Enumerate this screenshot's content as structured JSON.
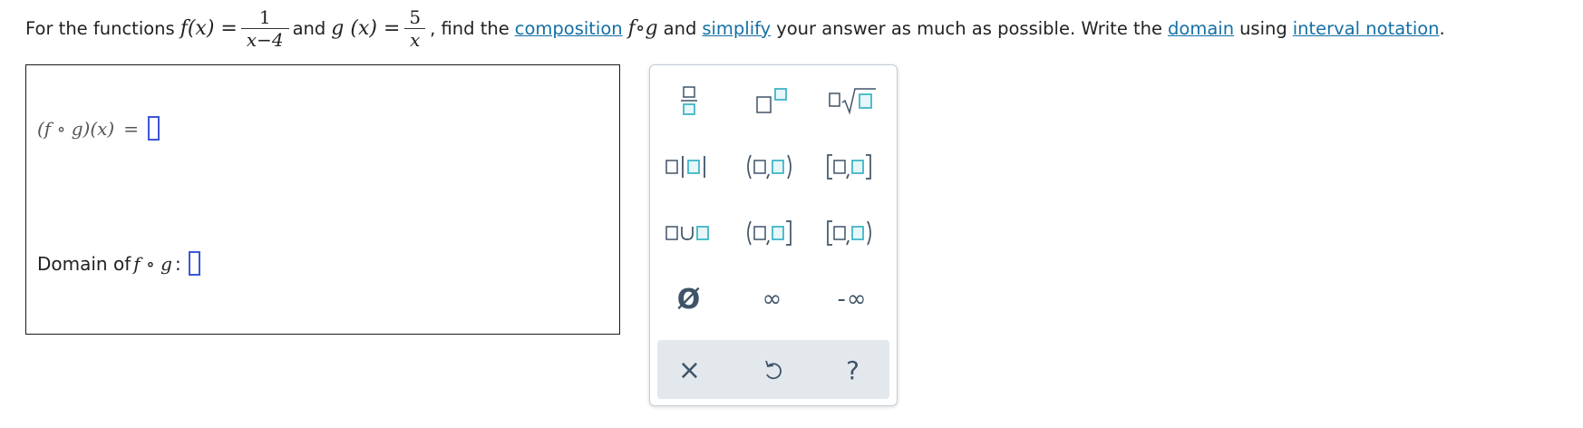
{
  "prompt": {
    "t1": "For the functions",
    "f_call": "f(x) =",
    "f_num": "1",
    "f_den": "x−4",
    "t2": "and",
    "g_call": "g (x) =",
    "g_num": "5",
    "g_den": "x",
    "t3": ", find the",
    "link_composition": "composition",
    "fog": "f∘g",
    "t4": "and",
    "link_simplify": "simplify",
    "t5": "your answer as much as possible. Write the",
    "link_domain": "domain",
    "t6": "using",
    "link_interval": "interval notation",
    "t7": "."
  },
  "answer": {
    "composition_label": "(f ∘ g)(x)",
    "equals": "=",
    "domain_label_prefix": "Domain of",
    "domain_fog": "f ∘ g",
    "domain_colon": ":"
  },
  "palette": {
    "buttons": [
      {
        "icon": "fraction-icon"
      },
      {
        "icon": "superscript-icon"
      },
      {
        "icon": "nth-root-icon"
      },
      {
        "icon": "absolute-value-icon"
      },
      {
        "icon": "open-interval-icon"
      },
      {
        "icon": "closed-interval-icon"
      },
      {
        "icon": "union-icon"
      },
      {
        "icon": "left-open-interval-icon"
      },
      {
        "icon": "right-open-interval-icon"
      },
      {
        "icon": "empty-set-icon",
        "label": "Ø"
      },
      {
        "icon": "infinity-icon",
        "label": "∞"
      },
      {
        "icon": "negative-infinity-icon",
        "label": "-∞"
      }
    ],
    "actions": [
      {
        "icon": "clear-icon",
        "label": "×"
      },
      {
        "icon": "undo-icon"
      },
      {
        "icon": "help-icon",
        "label": "?"
      }
    ]
  },
  "colors": {
    "link": "#1570a6",
    "placeholder": "#3d55d9",
    "palette_icon": "#3f5468",
    "palette_accent": "#3fb6c8",
    "action_bar": "#e3e8ed"
  }
}
